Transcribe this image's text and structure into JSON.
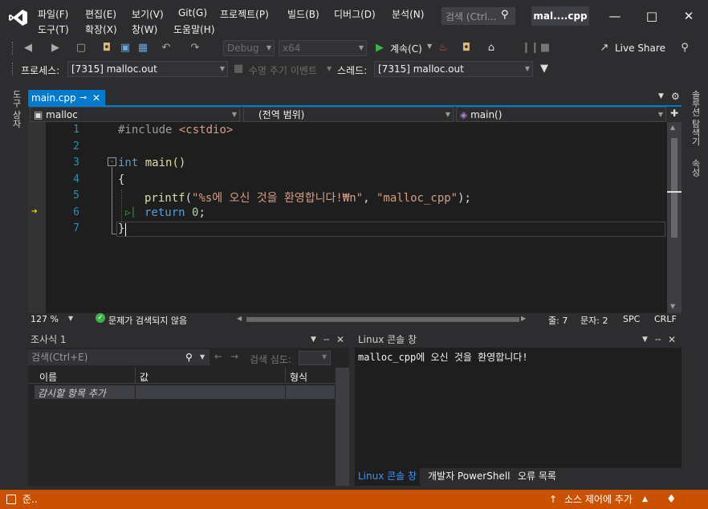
{
  "menu": {
    "row1": [
      "파일(F)",
      "편집(E)",
      "보기(V)",
      "Git(G)",
      "프로젝트(P)",
      "빌드(B)",
      "디버그(D)",
      "분석(N)"
    ],
    "row2": [
      "도구(T)",
      "확장(X)",
      "창(W)",
      "도움말(H)"
    ]
  },
  "search": {
    "placeholder": "검색 (Ctrl..."
  },
  "solution_title": "mal....cpp",
  "toolbar": {
    "config": "Debug",
    "platform": "x64",
    "continue_label": "계속(C)",
    "live_share": "Live Share"
  },
  "debug_bar": {
    "process_label": "프로세스:",
    "process_value": "[7315] malloc.out",
    "lifecycle_label": "수명 주기 이벤트",
    "thread_label": "스레드:",
    "thread_value": "[7315] malloc.out"
  },
  "left_strip": "도구 상자",
  "right_strip": {
    "explorer": "솔루션 탐색기",
    "properties": "속성"
  },
  "document_tab": {
    "name": "main.cpp",
    "pin": "⊸"
  },
  "nav": {
    "project": "malloc",
    "scope": "(전역 범위)",
    "member": "main()"
  },
  "code": {
    "line_numbers": [
      "1",
      "2",
      "3",
      "4",
      "5",
      "6",
      "7"
    ],
    "l1_directive": "#include",
    "l1_header": " <cstdio>",
    "l3_kw": "int",
    "l3_fn": " main()",
    "l4": "{",
    "l5_fn": "printf",
    "l5_paren": "(",
    "l5_str1": "\"%s에 오신 것을 환영합니다!₩n\"",
    "l5_comma": ", ",
    "l5_str2": "\"malloc_cpp\"",
    "l5_end": ");",
    "l6_kw": "return",
    "l6_num": " 0",
    "l6_end": ";",
    "l7": "}"
  },
  "editor_status": {
    "zoom": "127 %",
    "issues": "문제가 검색되지 않음",
    "line": "줄: 7",
    "col": "문자: 2",
    "spc": "SPC",
    "crlf": "CRLF"
  },
  "watch": {
    "title": "조사식 1",
    "search_placeholder": "검색(Ctrl+E)",
    "depth_label": "검색 심도:",
    "columns": [
      "이름",
      "값",
      "형식"
    ],
    "add_item": "감시할 항목 추가"
  },
  "console": {
    "title": "Linux 콘솔 창",
    "output": "malloc_cpp에 오신 것을 환영합니다!",
    "tabs": [
      "Linux 콘솔 창",
      "개발자 PowerShell",
      "오류 목록"
    ]
  },
  "statusbar": {
    "ready": "준..",
    "source_control": "소스 제어에 추가"
  },
  "colors": {
    "accent": "#007acc",
    "statusbar": "#ca5100",
    "editor_bg": "#1e1e1e"
  }
}
